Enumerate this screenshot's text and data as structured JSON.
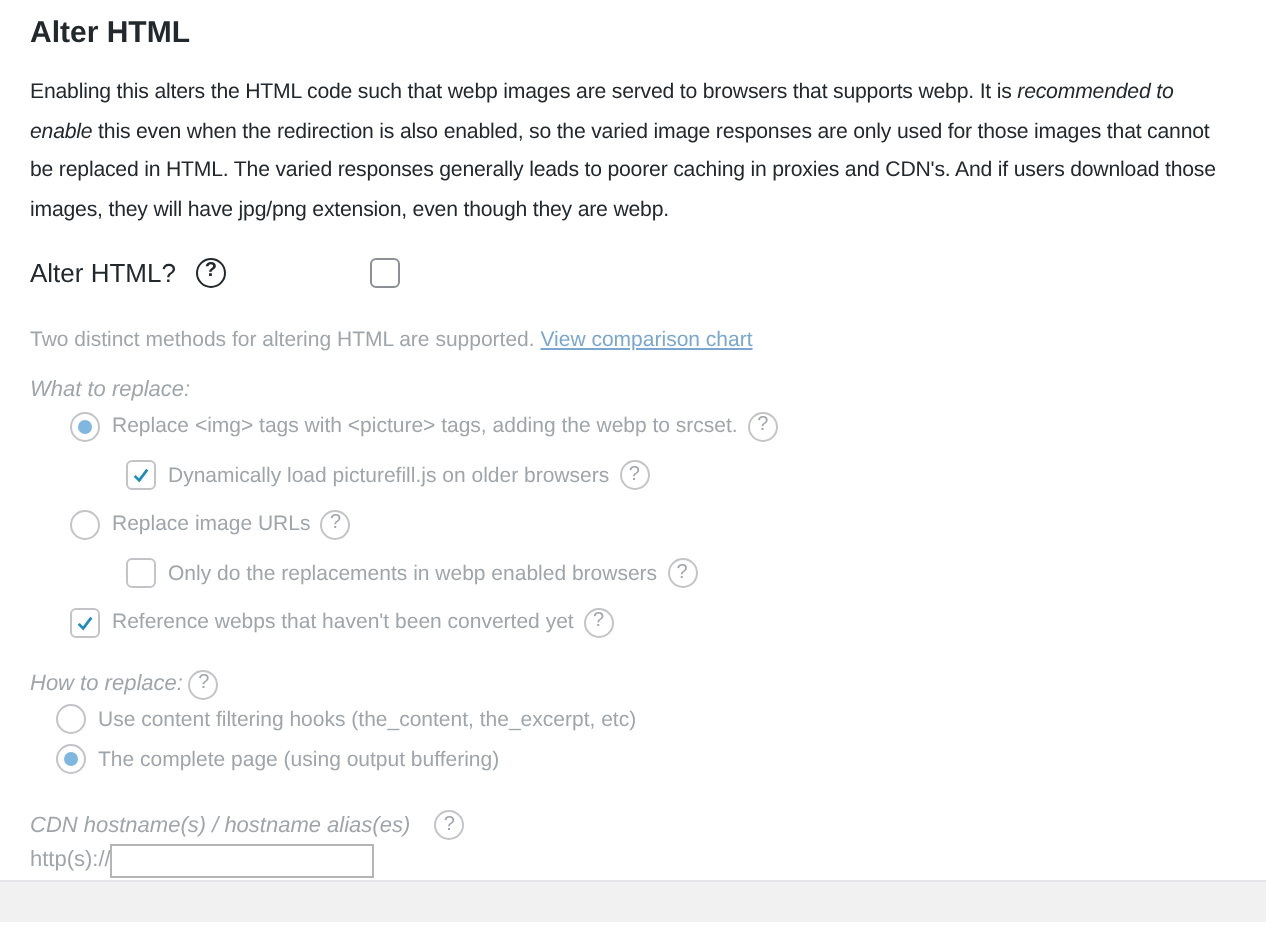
{
  "heading": "Alter HTML",
  "description": "Enabling this alters the HTML code such that webp images are served to browsers that supports webp. It is *recommended to enable* this even when the redirection is also enabled, so the varied image responses are only used for those images that cannot be replaced in HTML. The varied responses generally leads to poorer caching in proxies and CDN's. And if users download those images, they will have jpg/png extension, even though they are webp.",
  "alter_html": {
    "label": "Alter HTML?",
    "help": "?",
    "checked": false
  },
  "options": {
    "disabled": true,
    "intro": "Two distinct methods for altering HTML are supported.",
    "intro_link": "View comparison chart",
    "what_to_replace": {
      "label": "What to replace:",
      "items": [
        {
          "kind": "radio",
          "label": "Replace <img> tags with <picture> tags, adding the webp to srcset.",
          "help": "?",
          "selected": true,
          "children": [
            {
              "kind": "checkbox",
              "label": "Dynamically load picturefill.js on older browsers",
              "help": "?",
              "checked": true
            }
          ]
        },
        {
          "kind": "radio",
          "label": "Replace image URLs",
          "help": "?",
          "selected": false,
          "children": [
            {
              "kind": "checkbox",
              "label": "Only do the replacements in webp enabled browsers",
              "help": "?",
              "checked": false
            }
          ]
        }
      ]
    },
    "reference": {
      "kind": "checkbox",
      "label": "Reference webps that haven't been converted yet",
      "help": "?",
      "checked": true
    },
    "how_to_replace": {
      "label": "How to replace:",
      "help": "?",
      "items": [
        {
          "kind": "radio",
          "label": "Use content filtering hooks (the_content, the_excerpt, etc)",
          "selected": false
        },
        {
          "kind": "radio",
          "label": "The complete page (using output buffering)",
          "selected": true
        }
      ]
    },
    "cdn": {
      "label": "CDN hostname(s) / hostname alias(es)",
      "help": "?",
      "prefix": "http(s)://"
    }
  }
}
